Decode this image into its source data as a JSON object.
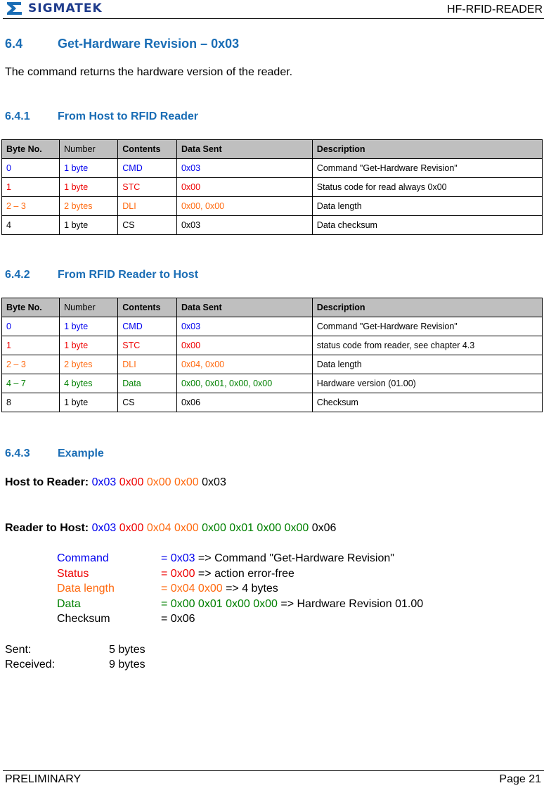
{
  "header": {
    "logo_icon": "sigmatek-sigma-logo",
    "brand": "SIGMATEK",
    "doc_title": "HF-RFID-READER"
  },
  "section": {
    "number": "6.4",
    "title": "Get-Hardware Revision – 0x03",
    "intro": "The command returns the hardware version of the reader."
  },
  "colors": {
    "cmd": "#0000ee",
    "stc": "#ee0000",
    "dli": "#ff6a10",
    "data": "#008000",
    "cs": "#000000",
    "heading": "#1a6db5",
    "table_header_bg": "#bfbfbf"
  },
  "host_to_reader": {
    "number": "6.4.1",
    "title": "From Host to RFID Reader",
    "columns": [
      "Byte No.",
      "Number",
      "Contents",
      "Data Sent",
      "Description"
    ],
    "rows": [
      {
        "byte": "0",
        "number": "1 byte",
        "contents": "CMD",
        "data": "0x03",
        "description": "Command \"Get-Hardware Revision\"",
        "color": "blue"
      },
      {
        "byte": "1",
        "number": "1 byte",
        "contents": "STC",
        "data": "0x00",
        "description": "Status code for read always 0x00",
        "color": "red"
      },
      {
        "byte": "2 – 3",
        "number": "2 bytes",
        "contents": "DLI",
        "data": "0x00, 0x00",
        "description": "Data length",
        "color": "orange"
      },
      {
        "byte": "4",
        "number": "1 byte",
        "contents": "CS",
        "data": "0x03",
        "description": "Data checksum",
        "color": "black"
      }
    ]
  },
  "reader_to_host": {
    "number": "6.4.2",
    "title": "From RFID Reader to Host",
    "columns": [
      "Byte No.",
      "Number",
      "Contents",
      "Data Sent",
      "Description"
    ],
    "rows": [
      {
        "byte": "0",
        "number": "1 byte",
        "contents": "CMD",
        "data": "0x03",
        "description": "Command \"Get-Hardware Revision\"",
        "color": "blue"
      },
      {
        "byte": "1",
        "number": "1 byte",
        "contents": "STC",
        "data": "0x00",
        "description": "status code from reader, see chapter 4.3",
        "color": "red"
      },
      {
        "byte": "2 – 3",
        "number": "2 bytes",
        "contents": "DLI",
        "data": "0x04, 0x00",
        "description": "Data length",
        "color": "orange"
      },
      {
        "byte": "4 – 7",
        "number": "4 bytes",
        "contents": "Data",
        "data": "0x00, 0x01, 0x00, 0x00",
        "description": "Hardware version (01.00)",
        "color": "green"
      },
      {
        "byte": "8",
        "number": "1 byte",
        "contents": "CS",
        "data": "0x06",
        "description": "Checksum",
        "color": "black"
      }
    ]
  },
  "example": {
    "number": "6.4.3",
    "title": "Example",
    "host_label": "Host to Reader:",
    "host_bytes": [
      {
        "v": "0x03",
        "color": "blue"
      },
      {
        "v": "0x00",
        "color": "red"
      },
      {
        "v": "0x00",
        "color": "orange"
      },
      {
        "v": "0x00",
        "color": "orange"
      },
      {
        "v": "0x03",
        "color": "black"
      }
    ],
    "reader_label": "Reader to Host:",
    "reader_bytes": [
      {
        "v": "0x03",
        "color": "blue"
      },
      {
        "v": "0x00",
        "color": "red"
      },
      {
        "v": "0x04",
        "color": "orange"
      },
      {
        "v": "0x00",
        "color": "orange"
      },
      {
        "v": "0x00",
        "color": "green"
      },
      {
        "v": "0x01",
        "color": "green"
      },
      {
        "v": "0x00",
        "color": "green"
      },
      {
        "v": "0x00",
        "color": "green"
      },
      {
        "v": "0x06",
        "color": "black"
      }
    ],
    "legend": [
      {
        "label": "Command",
        "value": "= 0x03",
        "meaning": " => Command \"Get-Hardware Revision\"",
        "color": "blue"
      },
      {
        "label": "Status",
        "value": "= 0x00",
        "meaning": " => action error-free",
        "color": "red"
      },
      {
        "label": "Data length",
        "value": "= 0x04 0x00",
        "meaning": " => 4 bytes",
        "color": "orange"
      },
      {
        "label": "Data",
        "value": "= 0x00 0x01 0x00 0x00",
        "meaning": " => Hardware Revision 01.00",
        "color": "green"
      },
      {
        "label": "Checksum",
        "value": "= 0x06",
        "meaning": "",
        "color": "black"
      }
    ],
    "sent_label": "Sent:",
    "sent_value": "5 bytes",
    "received_label": "Received:",
    "received_value": "9 bytes"
  },
  "footer": {
    "status": "PRELIMINARY",
    "page": "Page 21"
  }
}
